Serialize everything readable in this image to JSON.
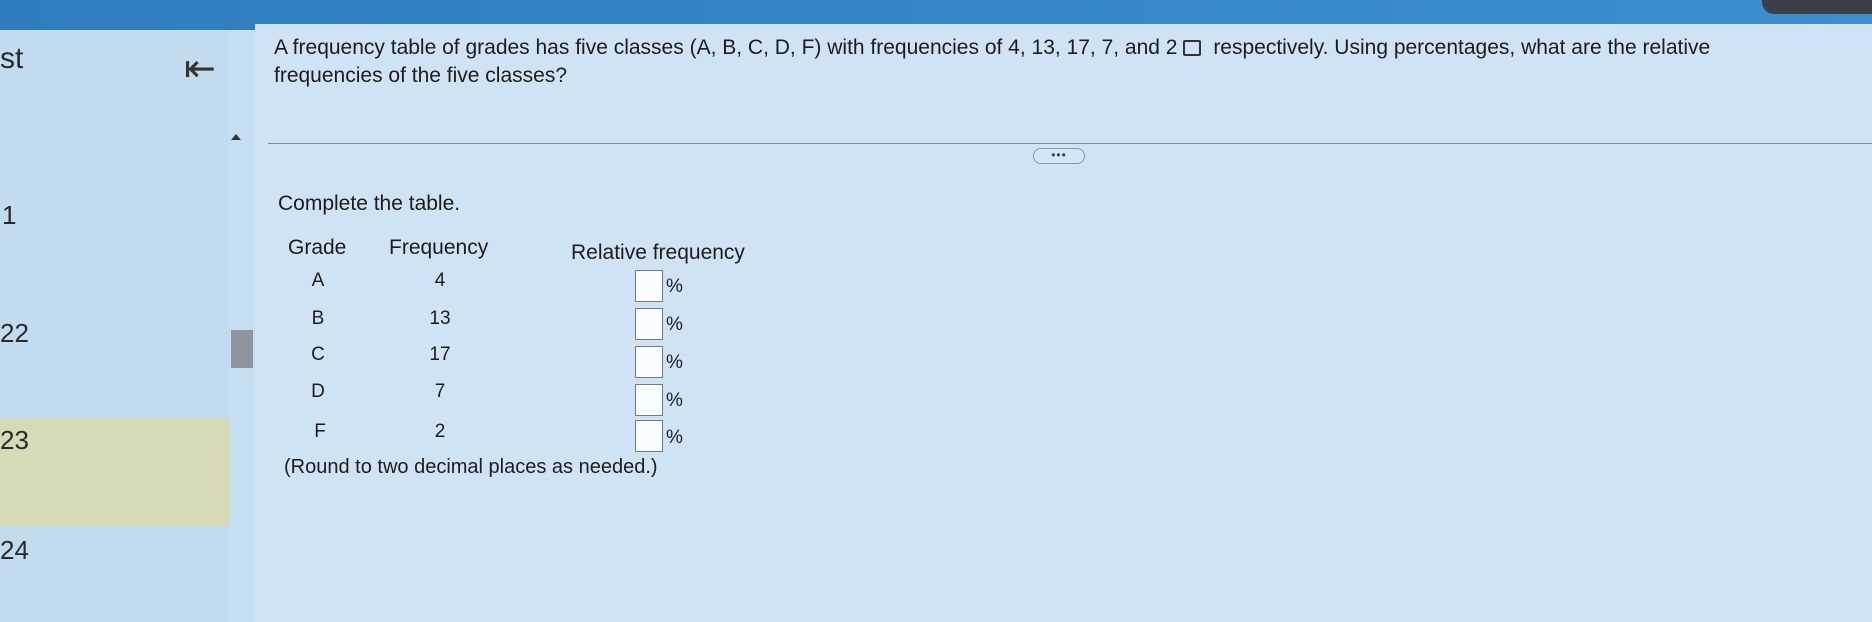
{
  "sidebar": {
    "partial_title": "st",
    "items": [
      {
        "label": "1"
      },
      {
        "label": "22"
      },
      {
        "label": "23",
        "active": true
      },
      {
        "label": "24"
      }
    ]
  },
  "question": {
    "text_before_icon": "A frequency table of grades has five classes (A, B, C, D, F) with frequencies of 4, 13, 17, 7, and 2",
    "text_after_icon": " respectively. Using percentages, what are the relative frequencies of the five classes?"
  },
  "more_button": "•••",
  "instruction": "Complete the table.",
  "table": {
    "headers": {
      "grade": "Grade",
      "frequency": "Frequency",
      "relative": "Relative frequency"
    },
    "rows": [
      {
        "grade": "A",
        "frequency": "4",
        "relative": "",
        "unit": "%"
      },
      {
        "grade": "B",
        "frequency": "13",
        "relative": "",
        "unit": "%"
      },
      {
        "grade": "C",
        "frequency": "17",
        "relative": "",
        "unit": "%"
      },
      {
        "grade": "D",
        "frequency": "7",
        "relative": "",
        "unit": "%"
      },
      {
        "grade": "F",
        "frequency": "2",
        "relative": "",
        "unit": "%"
      }
    ]
  },
  "note": "(Round to two decimal places as needed.)"
}
